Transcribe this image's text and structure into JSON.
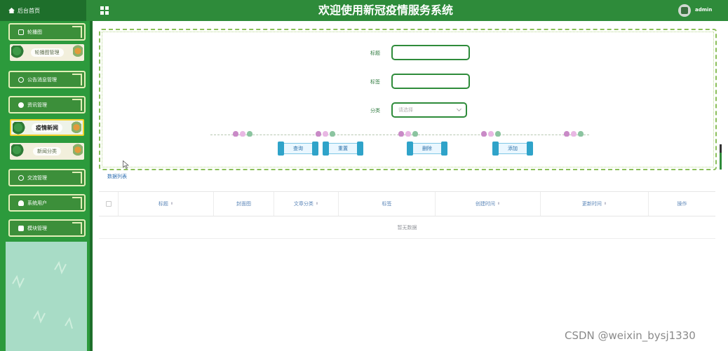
{
  "header": {
    "home_tab": "后台首页",
    "title": "欢迎使用新冠疫情服务系统",
    "user": "admin"
  },
  "sidebar": {
    "groups": [
      {
        "label": "轮播图",
        "items": [
          "轮播图管理"
        ]
      },
      {
        "label": "公告消息管理",
        "items": []
      },
      {
        "label": "资讯管理",
        "items": [
          "疫情新闻",
          "新闻分类"
        ]
      },
      {
        "label": "交流管理",
        "items": []
      },
      {
        "label": "系统用户",
        "items": []
      },
      {
        "label": "模块管理",
        "items": []
      }
    ],
    "active_item": "疫情新闻"
  },
  "search_form": {
    "fields": [
      {
        "label": "标题",
        "value": ""
      },
      {
        "label": "标签",
        "value": ""
      }
    ],
    "category": {
      "label": "分类",
      "placeholder": "请选择"
    },
    "buttons": [
      "查询",
      "重置",
      "删除",
      "添加"
    ]
  },
  "table": {
    "title": "数据列表",
    "columns": [
      "标题",
      "封面图",
      "文章分类",
      "标签",
      "创建时间",
      "更新时间",
      "操作"
    ],
    "sortable": [
      true,
      false,
      true,
      false,
      true,
      true,
      false
    ],
    "empty_text": "暂无数据",
    "rows": []
  },
  "watermark": "CSDN @weixin_bysj1330",
  "colors": {
    "header": "#2e8b3a",
    "sidebar": "#2c9a3c",
    "accent": "#2e8b3a",
    "active_border": "#f2d12a"
  }
}
